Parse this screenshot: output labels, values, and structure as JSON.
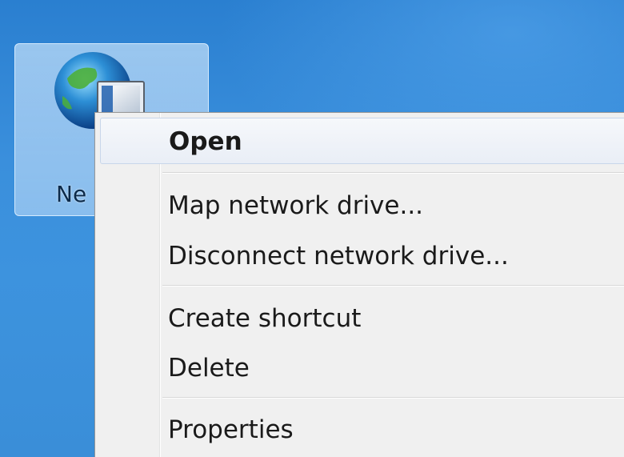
{
  "desktop": {
    "icon": {
      "label": "Ne",
      "icon_name": "network-globe-icon"
    }
  },
  "context_menu": {
    "items": [
      {
        "label": "Open",
        "default": true
      },
      {
        "label": "Map network drive..."
      },
      {
        "label": "Disconnect network drive..."
      },
      {
        "label": "Create shortcut"
      },
      {
        "label": "Delete"
      },
      {
        "label": "Properties"
      }
    ]
  },
  "colors": {
    "desktop_background": "#2f83cf",
    "menu_background": "#f0f0f0",
    "highlight_border": "#c8d6ea"
  }
}
